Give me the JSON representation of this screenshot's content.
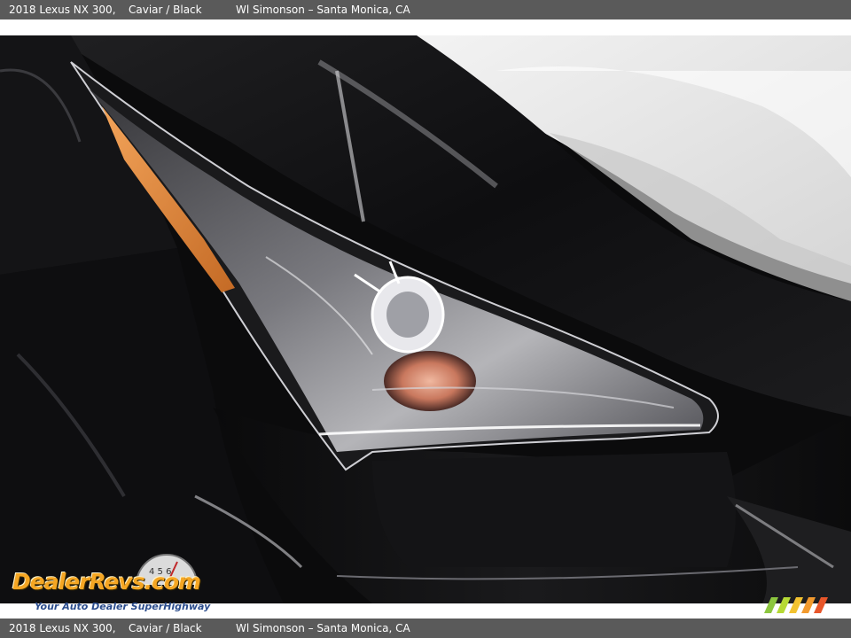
{
  "caption": {
    "model": "2018 Lexus NX 300,",
    "color": "Caviar / Black",
    "dealer": "Wl Simonson – Santa Monica, CA"
  },
  "watermark": {
    "brand": "DealerRevs.com",
    "tagline": "Your Auto Dealer SuperHighway",
    "gauge_digits": "4 5 6"
  },
  "photo": {
    "subject": "headlight-closeup",
    "colors": {
      "paint": "#0b0b0c",
      "amber": "#e2873a",
      "lens": "#d9d9dc"
    }
  },
  "icons": {
    "gauge": "speedometer-icon",
    "stripes": "speed-stripes-icon"
  }
}
